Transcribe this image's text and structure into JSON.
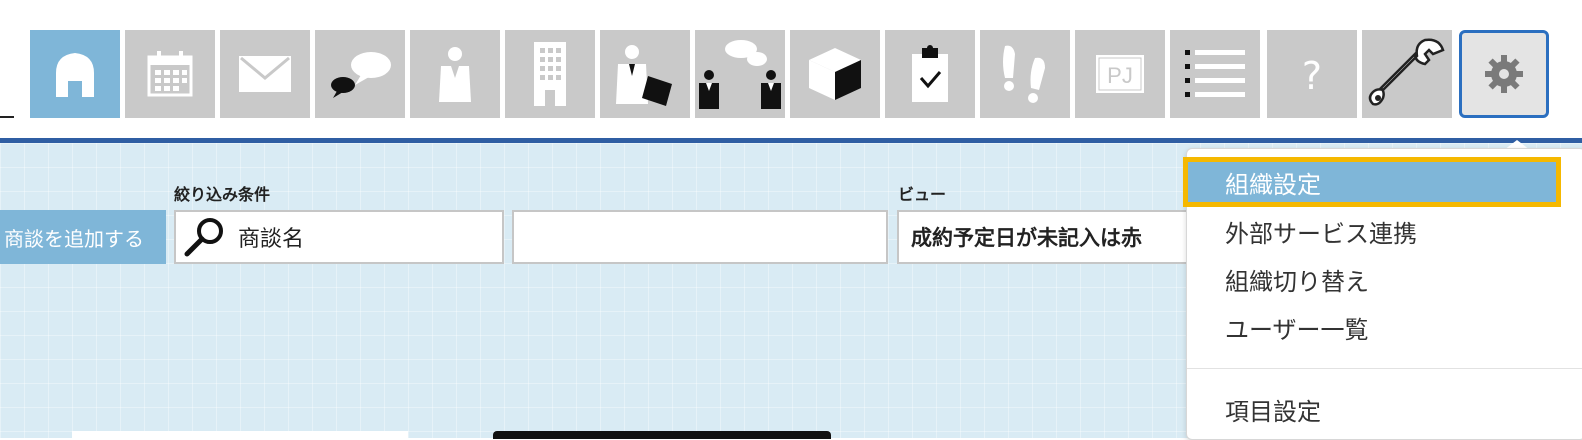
{
  "toolbar": {
    "items": [
      {
        "icon": "home-icon",
        "state": "active"
      },
      {
        "icon": "calendar-icon"
      },
      {
        "icon": "mail-icon"
      },
      {
        "icon": "chat-bubbles-icon"
      },
      {
        "icon": "person-icon"
      },
      {
        "icon": "building-icon"
      },
      {
        "icon": "person-document-icon"
      },
      {
        "icon": "meeting-icon"
      },
      {
        "icon": "cube-icon"
      },
      {
        "icon": "clipboard-check-icon"
      },
      {
        "icon": "footprints-icon"
      },
      {
        "icon": "project-icon",
        "text": "PJ"
      },
      {
        "icon": "list-icon"
      },
      {
        "icon": "help-icon",
        "text": "?"
      },
      {
        "icon": "wrench-icon"
      },
      {
        "icon": "gear-icon",
        "state": "selected"
      }
    ]
  },
  "colors": {
    "accent_blue": "#7fb6d8",
    "divider_navy": "#2f5ea3",
    "highlight_yellow": "#f5b800",
    "background": "#d9ebf4"
  },
  "filters": {
    "label": "絞り込み条件",
    "add_button_label": "商談を追加する",
    "search_value": "商談名",
    "second_value": ""
  },
  "view": {
    "label": "ビュー",
    "selected": "成約予定日が未記入は赤"
  },
  "settings_menu": {
    "items": [
      {
        "label": "組織設定",
        "highlighted": true
      },
      {
        "label": "外部サービス連携"
      },
      {
        "label": "組織切り替え"
      },
      {
        "label": "ユーザー一覧"
      },
      {
        "label": "項目設定"
      }
    ]
  }
}
